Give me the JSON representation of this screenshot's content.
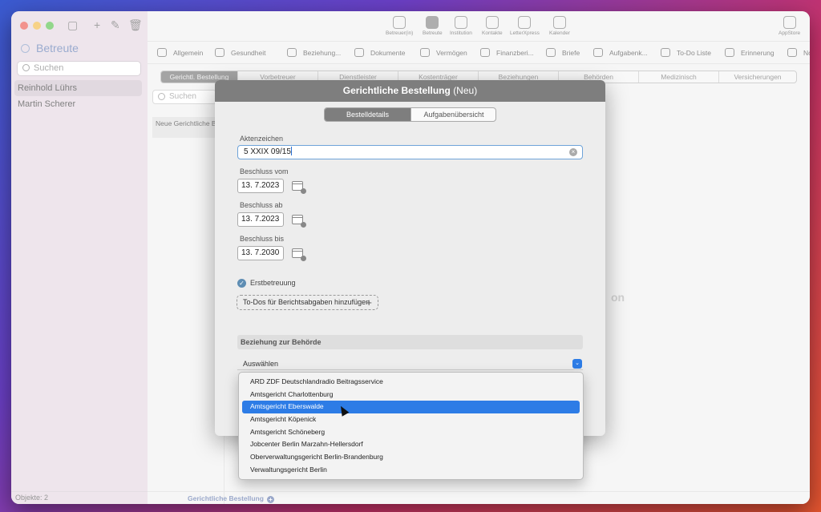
{
  "sidebar": {
    "title": "Betreute",
    "search_placeholder": "Suchen",
    "items": [
      {
        "label": "Reinhold Lührs",
        "selected": true
      },
      {
        "label": "Martin Scherer",
        "selected": false
      }
    ],
    "footer": "Objekte: 2"
  },
  "toolbar": {
    "items": [
      {
        "label": "Betreuer(in)",
        "icon": "person-badge-icon"
      },
      {
        "label": "Betreute",
        "icon": "person-icon",
        "active": true
      },
      {
        "label": "Institution",
        "icon": "building-icon"
      },
      {
        "label": "Kontakte",
        "icon": "contacts-icon"
      },
      {
        "label": "LetterXpress",
        "icon": "letter-icon"
      },
      {
        "label": "Kalender",
        "icon": "alarm-clock-icon"
      }
    ],
    "appstore": "AppStore"
  },
  "sections": [
    {
      "label": "Allgemein",
      "icon": "person-icon"
    },
    {
      "label": "Gesundheit",
      "icon": "medical-icon"
    },
    {
      "label": "Beziehung...",
      "icon": "people-icon"
    },
    {
      "label": "Dokumente",
      "icon": "folder-icon"
    },
    {
      "label": "Vermögen",
      "icon": "euro-icon"
    },
    {
      "label": "Finanzberi...",
      "icon": "chart-icon"
    },
    {
      "label": "Briefe",
      "icon": "document-icon"
    },
    {
      "label": "Aufgabenk...",
      "icon": "task-icon"
    },
    {
      "label": "To-Do Liste",
      "icon": "checkmark-icon"
    },
    {
      "label": "Erinnerung",
      "icon": "bell-icon"
    },
    {
      "label": "Notiz",
      "icon": "note-icon"
    }
  ],
  "tabs": [
    "Gerichtl. Bestellung",
    "Vorbetreuer",
    "Dienstleister",
    "Kostenträger",
    "Beziehungen",
    "Behörden",
    "Medizinisch",
    "Versicherungen"
  ],
  "list": {
    "search_placeholder": "Suchen",
    "item_label": "Neue Gerichtliche B"
  },
  "bottom_bar": {
    "label": "Gerichtliche Bestellung"
  },
  "background_text": "on",
  "dialog": {
    "title": "Gerichtliche Bestellung",
    "title_suffix": "(Neu)",
    "segments": [
      "Bestelldetails",
      "Aufgabenübersicht"
    ],
    "aktenzeichen": {
      "label": "Aktenzeichen",
      "value": "5 XXIX 09/15"
    },
    "beschluss_vom": {
      "label": "Beschluss vom",
      "value": "13.  7.2023"
    },
    "beschluss_ab": {
      "label": "Beschluss ab",
      "value": "13.  7.2023"
    },
    "beschluss_bis": {
      "label": "Beschluss bis",
      "value": "13.  7.2030"
    },
    "erstbetreuung": {
      "label": "Erstbetreuung",
      "checked": true
    },
    "todo_button": "To-Dos für Berichtsabgaben hinzufügen",
    "section_label": "Beziehung zur Behörde",
    "select_value": "Auswählen"
  },
  "dropdown": {
    "options": [
      "ARD ZDF Deutschlandradio Beitragsservice",
      "Amtsgericht Charlottenburg",
      "Amtsgericht Eberswalde",
      "Amtsgericht Köpenick",
      "Amtsgericht Schöneberg",
      "Jobcenter Berlin Marzahn-Hellersdorf",
      "Oberverwaltungsgericht Berlin-Brandenburg",
      "Verwaltungsgericht Berlin"
    ],
    "highlighted": "Amtsgericht Eberswalde"
  },
  "colors": {
    "accent": "#2d7ce6",
    "header_gray": "#7e7e7e",
    "sidebar": "#e6d9e3"
  }
}
